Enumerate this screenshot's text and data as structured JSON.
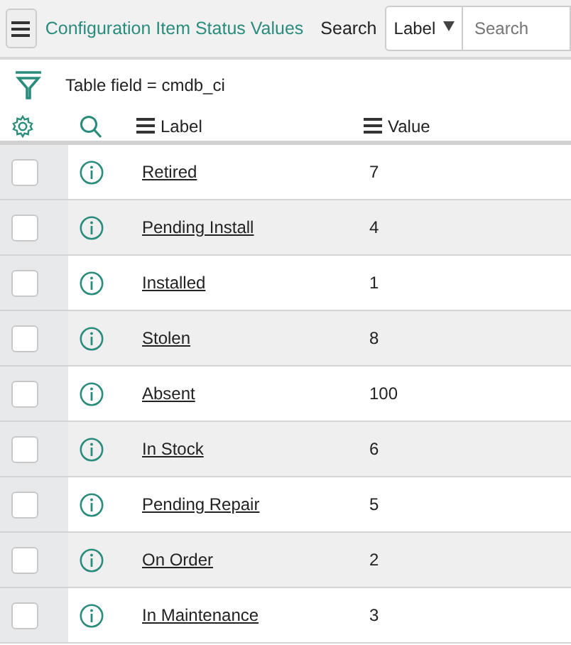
{
  "header": {
    "title": "Configuration Item Status Values",
    "search_label": "Search",
    "search_field": {
      "value": "Label"
    },
    "search_input": {
      "placeholder": "Search"
    }
  },
  "filter": {
    "text": "Table field = cmdb_ci"
  },
  "table": {
    "columns": [
      "Label",
      "Value"
    ],
    "rows": [
      {
        "label": "Retired",
        "value": "7",
        "checked": false
      },
      {
        "label": "Pending Install",
        "value": "4",
        "checked": false
      },
      {
        "label": "Installed",
        "value": "1",
        "checked": false
      },
      {
        "label": "Stolen",
        "value": "8",
        "checked": false
      },
      {
        "label": "Absent",
        "value": "100",
        "checked": false
      },
      {
        "label": "In Stock",
        "value": "6",
        "checked": false
      },
      {
        "label": "Pending Repair",
        "value": "5",
        "checked": false
      },
      {
        "label": "On Order",
        "value": "2",
        "checked": false
      },
      {
        "label": "In Maintenance",
        "value": "3",
        "checked": false
      }
    ]
  }
}
